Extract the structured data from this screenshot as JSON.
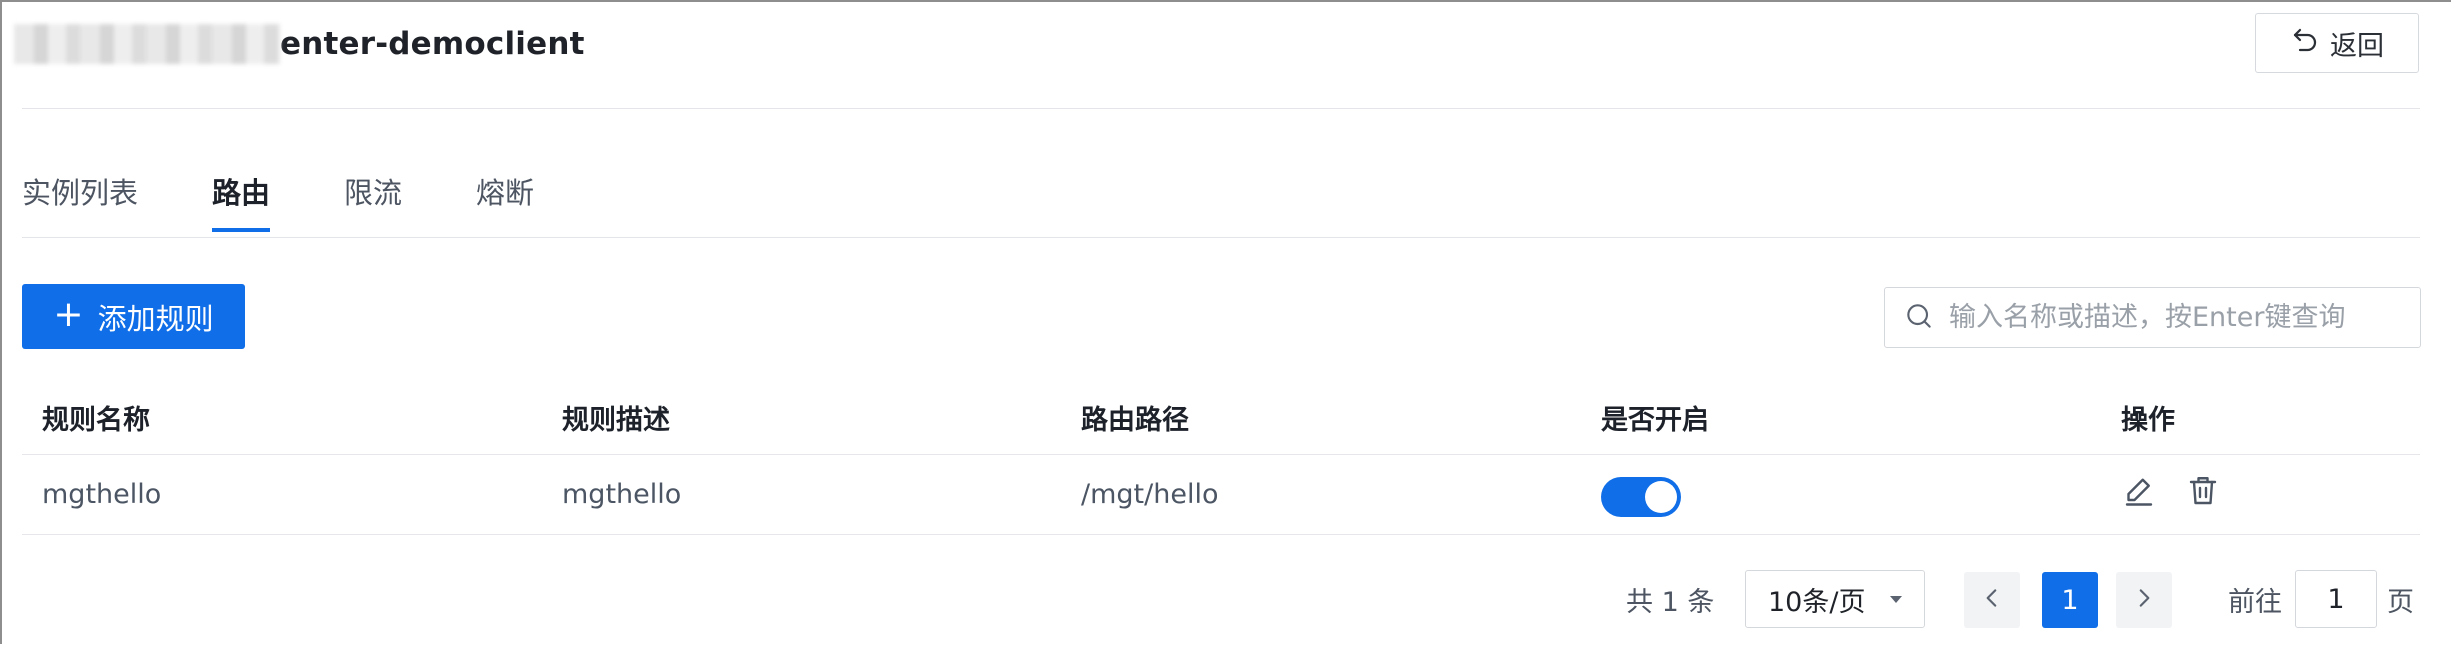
{
  "header": {
    "title_suffix": "enter-democlient",
    "back_label": "返回"
  },
  "tabs": [
    {
      "label": "实例列表",
      "active": false
    },
    {
      "label": "路由",
      "active": true
    },
    {
      "label": "限流",
      "active": false
    },
    {
      "label": "熔断",
      "active": false
    }
  ],
  "toolbar": {
    "add_label": "添加规则",
    "search_placeholder": "输入名称或描述，按Enter键查询"
  },
  "table": {
    "columns": [
      "规则名称",
      "规则描述",
      "路由路径",
      "是否开启",
      "操作"
    ],
    "rows": [
      {
        "name": "mgthello",
        "desc": "mgthello",
        "path": "/mgt/hello",
        "enabled": true
      }
    ]
  },
  "pagination": {
    "total": "共 1 条",
    "page_size": "10条/页",
    "current_page": "1",
    "goto_label": "前往",
    "goto_value": "1",
    "page_suffix": "页"
  },
  "colors": {
    "primary": "#0f6ee8"
  }
}
